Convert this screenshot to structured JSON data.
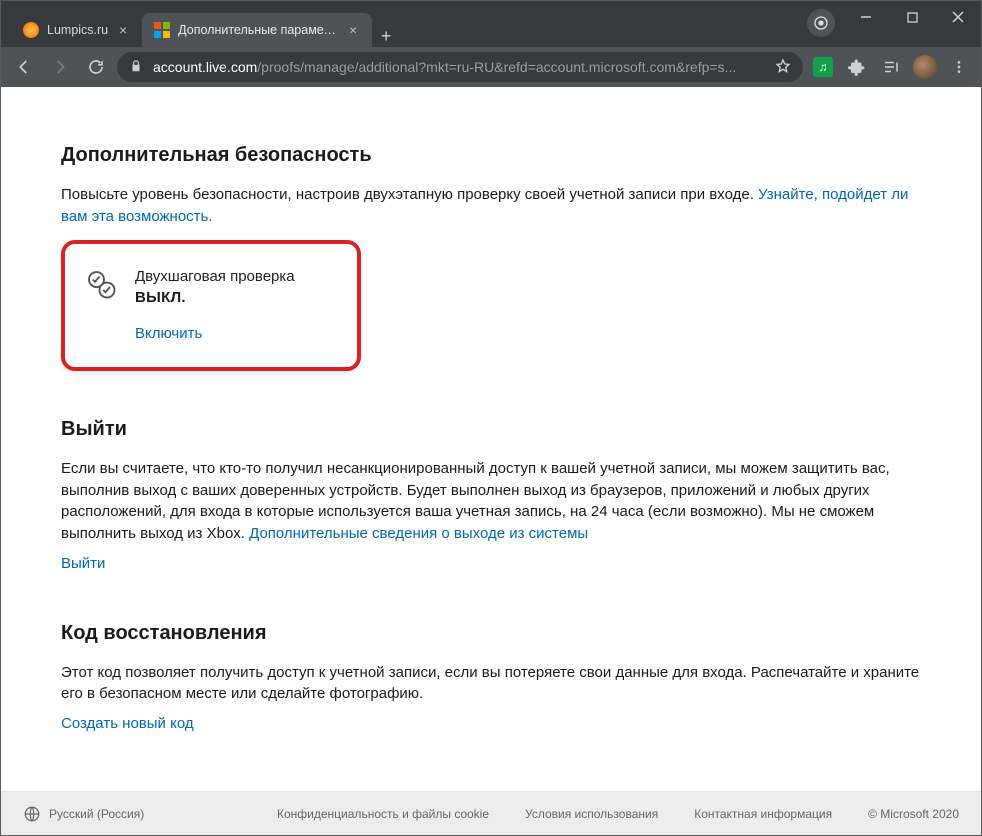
{
  "browser": {
    "tabs": [
      {
        "title": "Lumpics.ru"
      },
      {
        "title": "Дополнительные параметры бе"
      }
    ],
    "url_host": "account.live.com",
    "url_path": "/proofs/manage/additional?mkt=ru-RU&refd=account.microsoft.com&refp=s..."
  },
  "page": {
    "security": {
      "heading": "Дополнительная безопасность",
      "desc_prefix": "Повысьте уровень безопасности, настроив двухэтапную проверку своей учетной записи при входе. ",
      "desc_link": "Узнайте, подойдет ли вам эта возможность.",
      "card": {
        "title": "Двухшаговая проверка",
        "status": "ВЫКЛ.",
        "action": "Включить"
      }
    },
    "signout": {
      "heading": "Выйти",
      "desc_prefix": "Если вы считаете, что кто-то получил несанкционированный доступ к вашей учетной записи, мы можем защитить вас, выполнив выход с ваших доверенных устройств. Будет выполнен выход из браузеров, приложений и любых других расположений, для входа в которые используется ваша учетная запись, на 24 часа (если возможно). Мы не сможем выполнить выход из Xbox. ",
      "desc_link": "Дополнительные сведения о выходе из системы",
      "action": "Выйти"
    },
    "recovery": {
      "heading": "Код восстановления",
      "desc": "Этот код позволяет получить доступ к учетной записи, если вы потеряете свои данные для входа. Распечатайте и храните его в безопасном месте или сделайте фотографию.",
      "action": "Создать новый код"
    }
  },
  "footer": {
    "language": "Русский (Россия)",
    "links": {
      "privacy": "Конфиденциальность и файлы cookie",
      "terms": "Условия использования",
      "contact": "Контактная информация"
    },
    "copyright": "© Microsoft 2020"
  }
}
